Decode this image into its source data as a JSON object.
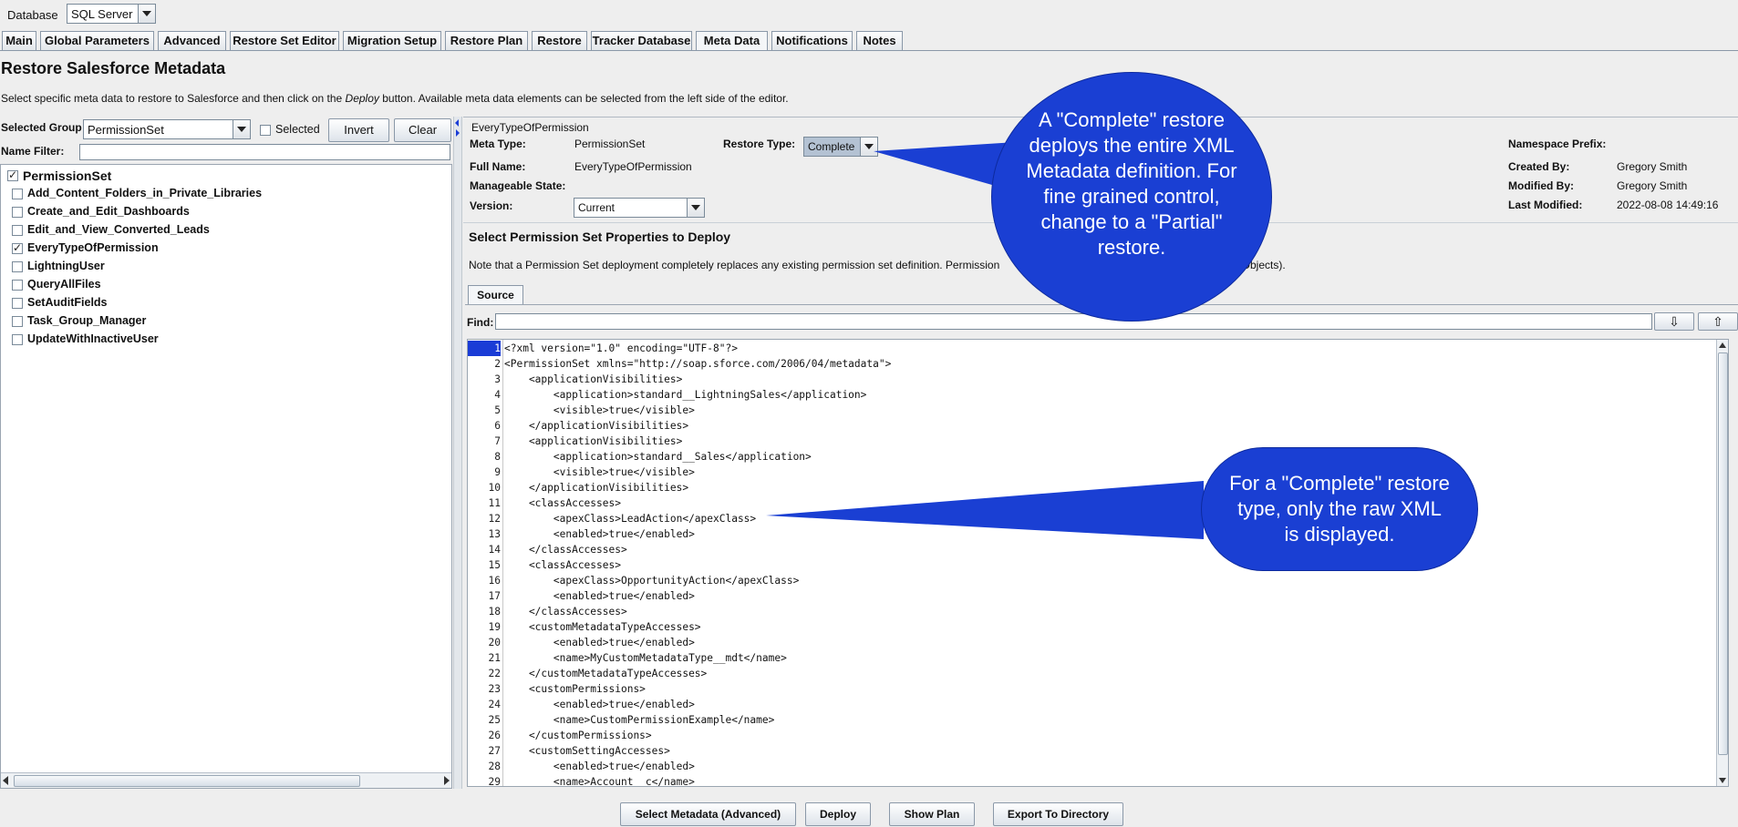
{
  "top": {
    "database_label": "Database",
    "database_value": "SQL Server"
  },
  "tabs": [
    {
      "label": "Main"
    },
    {
      "label": "Global Parameters"
    },
    {
      "label": "Advanced"
    },
    {
      "label": "Restore Set Editor"
    },
    {
      "label": "Migration Setup"
    },
    {
      "label": "Restore Plan"
    },
    {
      "label": "Restore"
    },
    {
      "label": "Tracker Database"
    },
    {
      "label": "Meta Data"
    },
    {
      "label": "Notifications"
    },
    {
      "label": "Notes"
    }
  ],
  "header": {
    "title": "Restore Salesforce Metadata",
    "desc_before": "Select specific meta data to restore to Salesforce and then click on the ",
    "desc_em": "Deploy",
    "desc_after": " button. Available meta data elements can be selected from the left side of the editor."
  },
  "left": {
    "selected_group_label": "Selected Group",
    "selected_group_value": "PermissionSet",
    "selected_label": "Selected",
    "invert": "Invert",
    "clear": "Clear",
    "name_filter_label": "Name Filter:",
    "name_filter_value": "",
    "root": "PermissionSet",
    "items": [
      {
        "label": "Add_Content_Folders_in_Private_Libraries",
        "checked": false
      },
      {
        "label": "Create_and_Edit_Dashboards",
        "checked": false
      },
      {
        "label": "Edit_and_View_Converted_Leads",
        "checked": false
      },
      {
        "label": "EveryTypeOfPermission",
        "checked": true
      },
      {
        "label": "LightningUser",
        "checked": false
      },
      {
        "label": "QueryAllFiles",
        "checked": false
      },
      {
        "label": "SetAuditFields",
        "checked": false
      },
      {
        "label": "Task_Group_Manager",
        "checked": false
      },
      {
        "label": "UpdateWithInactiveUser",
        "checked": false
      }
    ]
  },
  "detail": {
    "group_title": "EveryTypeOfPermission",
    "meta_type_label": "Meta Type:",
    "meta_type_value": "PermissionSet",
    "restore_type_label": "Restore Type:",
    "restore_type_value": "Complete",
    "full_name_label": "Full Name:",
    "full_name_value": "EveryTypeOfPermission",
    "manageable_state_label": "Manageable State:",
    "version_label": "Version:",
    "version_value": "Current",
    "namespace_label": "Namespace Prefix:",
    "created_by_label": "Created By:",
    "created_by_value": "Gregory Smith",
    "modified_by_label": "Modified By:",
    "modified_by_value": "Gregory Smith",
    "last_modified_label": "Last Modified:",
    "last_modified_value": "2022-08-08 14:49:16",
    "section_title": "Select Permission Set Properties to Deploy",
    "note_left": "Note that a Permission Set deployment completely replaces any existing permission set definition. Permission",
    "note_right": "omObjects).",
    "source_tab": "Source",
    "find_label": "Find:",
    "find_value": ""
  },
  "code_lines": [
    "<?xml version=\"1.0\" encoding=\"UTF-8\"?>",
    "<PermissionSet xmlns=\"http://soap.sforce.com/2006/04/metadata\">",
    "    <applicationVisibilities>",
    "        <application>standard__LightningSales</application>",
    "        <visible>true</visible>",
    "    </applicationVisibilities>",
    "    <applicationVisibilities>",
    "        <application>standard__Sales</application>",
    "        <visible>true</visible>",
    "    </applicationVisibilities>",
    "    <classAccesses>",
    "        <apexClass>LeadAction</apexClass>",
    "        <enabled>true</enabled>",
    "    </classAccesses>",
    "    <classAccesses>",
    "        <apexClass>OpportunityAction</apexClass>",
    "        <enabled>true</enabled>",
    "    </classAccesses>",
    "    <customMetadataTypeAccesses>",
    "        <enabled>true</enabled>",
    "        <name>MyCustomMetadataType__mdt</name>",
    "    </customMetadataTypeAccesses>",
    "    <customPermissions>",
    "        <enabled>true</enabled>",
    "        <name>CustomPermissionExample</name>",
    "    </customPermissions>",
    "    <customSettingAccesses>",
    "        <enabled>true</enabled>",
    "        <name>Account__c</name>"
  ],
  "callouts": {
    "complete_restore": "A \"Complete\" restore deploys the entire XML Metadata definition. For fine grained control, change to a \"Partial\" restore.",
    "raw_xml": "For a \"Complete\" restore type, only the raw XML is displayed."
  },
  "bottom": {
    "select_metadata": "Select Metadata (Advanced)",
    "deploy": "Deploy",
    "show_plan": "Show Plan",
    "export": "Export To Directory"
  },
  "colors": {
    "callout_blue": "#1a3fd3",
    "line_highlight": "#1a3cd6"
  }
}
